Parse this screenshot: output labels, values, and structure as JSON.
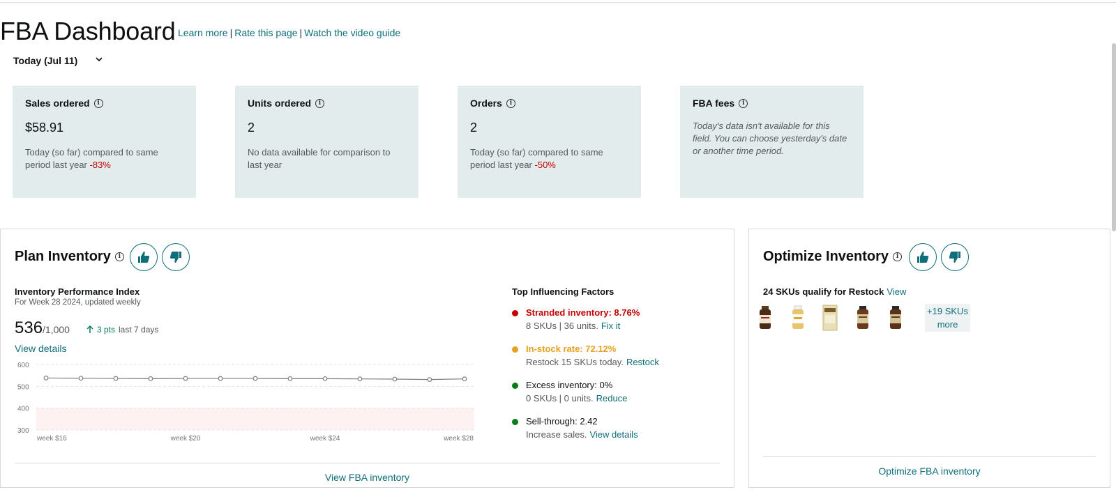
{
  "header": {
    "title": "FBA Dashboard",
    "links": [
      "Learn more",
      "Rate this page",
      "Watch the video guide"
    ],
    "separator": "|"
  },
  "date_filter": {
    "selected": "Today (Jul 11)"
  },
  "metrics": [
    {
      "label": "Sales ordered",
      "value": "$58.91",
      "desc": "Today (so far) compared to same period last year",
      "change": "-83%"
    },
    {
      "label": "Units ordered",
      "value": "2",
      "desc": "No data available for comparison to last year",
      "change": ""
    },
    {
      "label": "Orders",
      "value": "2",
      "desc": "Today (so far) compared to same period last year",
      "change": "-50%"
    },
    {
      "label": "FBA fees",
      "note": "Today's data isn't available for this field. You can choose yesterday's date or another time period."
    }
  ],
  "plan_inventory": {
    "title": "Plan Inventory",
    "ipi_title": "Inventory Performance Index",
    "ipi_subtitle": "For Week 28 2024, updated weekly",
    "score": "536",
    "score_max": "/1,000",
    "change": "3 pts",
    "change_period": "last 7 days",
    "view_details": "View details",
    "factors_title": "Top Influencing Factors",
    "factors": [
      {
        "label": "Stranded inventory: 8.76%",
        "detail": "8 SKUs | 36 units.",
        "action": "Fix it",
        "color": "#c40000"
      },
      {
        "label": "In-stock rate: 72.12%",
        "detail": "Restock 15 SKUs today.",
        "action": "Restock",
        "color": "#e7a020"
      },
      {
        "label": "Excess inventory: 0%",
        "detail": "0 SKUs | 0 units.",
        "action": "Reduce",
        "color": "#067d18"
      },
      {
        "label": "Sell-through: 2.42",
        "detail": "Increase sales.",
        "action": "View details",
        "color": "#067d18"
      }
    ],
    "footer_link": "View FBA inventory"
  },
  "optimize_inventory": {
    "title": "Optimize Inventory",
    "restock_text": "24 SKUs qualify for Restock",
    "restock_link": "View",
    "more_skus_line1": "+19 SKUs",
    "more_skus_line2": "more",
    "footer_link": "Optimize FBA inventory"
  },
  "chart_data": {
    "type": "line",
    "x": [
      "week $16",
      "week $17",
      "week $18",
      "week $19",
      "week $20",
      "week $21",
      "week $22",
      "week $23",
      "week $24",
      "week $25",
      "week $26",
      "week $27",
      "week $28"
    ],
    "x_tick_labels": [
      "week $16",
      "week $20",
      "week $24",
      "week $28"
    ],
    "series": [
      {
        "values": [
          538,
          537,
          536,
          535,
          536,
          536,
          536,
          535,
          535,
          534,
          533,
          531,
          534
        ]
      }
    ],
    "ylim": [
      300,
      600
    ],
    "y_ticks": [
      600,
      500,
      400,
      300
    ],
    "shaded_band": [
      300,
      400
    ],
    "grid": true,
    "line_color": "#7f7f7f",
    "band_color": "#fdf1f1"
  }
}
